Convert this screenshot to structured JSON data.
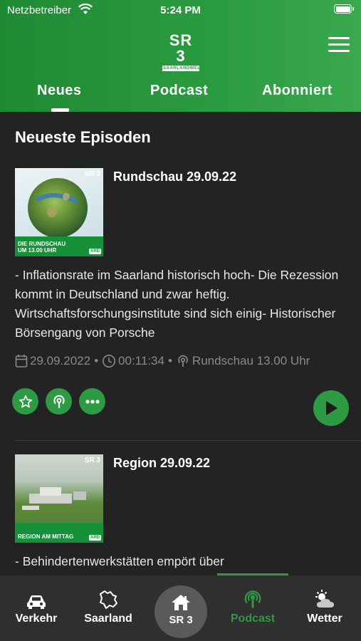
{
  "status_bar": {
    "carrier": "Netzbetreiber",
    "time": "5:24 PM"
  },
  "header": {
    "logo_main": "SR 3",
    "logo_sub": "SAARLANDWELLE",
    "tabs": [
      {
        "label": "Neues",
        "active": true
      },
      {
        "label": "Podcast",
        "active": false
      },
      {
        "label": "Abonniert",
        "active": false
      }
    ]
  },
  "section": {
    "title": "Neueste Episoden"
  },
  "episodes": [
    {
      "title": "Rundschau 29.09.22",
      "thumb_logo": "SR 3",
      "thumb_band": "DIE RUNDSCHAU UM 13.00 UHR",
      "thumb_badge": "ARD",
      "description": "- Inflationsrate im Saarland historisch hoch- Die Rezession kommt in Deutschland und zwar heftig. Wirtschaftsforschungsinstitute sind sich einig- Historischer Börsengang von Porsche",
      "date": "29.09.2022",
      "duration": "00:11:34",
      "podcast": "Rundschau 13.00 Uhr"
    },
    {
      "title": "Region 29.09.22",
      "thumb_logo": "SR 3",
      "thumb_band": "REGION AM MITTAG",
      "thumb_badge": "ARD",
      "description": "- Behindertenwerkstätten empört über"
    }
  ],
  "meta_separator": "•",
  "bottom_nav": {
    "items": [
      {
        "label": "Verkehr",
        "icon": "car-icon"
      },
      {
        "label": "Saarland",
        "icon": "saarland-map-icon"
      },
      {
        "label": "SR 3",
        "icon": "home-icon"
      },
      {
        "label": "Podcast",
        "icon": "podcast-icon",
        "active": true
      },
      {
        "label": "Wetter",
        "icon": "weather-icon"
      }
    ]
  },
  "colors": {
    "brand_green": "#2e9a43",
    "background": "#232323",
    "nav_background": "#2f2f2f",
    "meta_grey": "#8a8a8a"
  }
}
